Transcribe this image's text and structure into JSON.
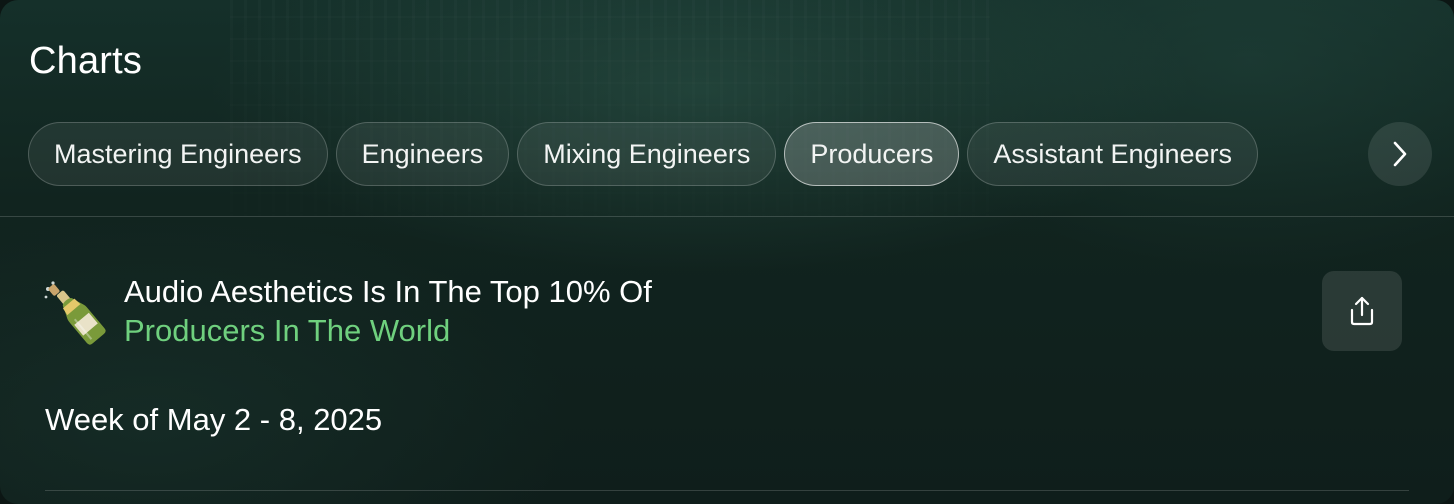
{
  "header": {
    "title": "Charts"
  },
  "tabs": [
    {
      "label": "Mastering Engineers",
      "active": false
    },
    {
      "label": "Engineers",
      "active": false
    },
    {
      "label": "Mixing Engineers",
      "active": false
    },
    {
      "label": "Producers",
      "active": true
    },
    {
      "label": "Assistant Engineers",
      "active": false
    }
  ],
  "next_button": {
    "icon": "chevron-right-icon"
  },
  "ranking": {
    "emoji_icon": "champagne-bottle-icon",
    "line1": "Audio Aesthetics Is In The Top 10% Of",
    "line2": "Producers In The World",
    "share_icon": "share-icon"
  },
  "week": {
    "label": "Week of May 2 - 8, 2025"
  },
  "colors": {
    "accent_green": "#6fd07e",
    "background": "#11241f"
  }
}
